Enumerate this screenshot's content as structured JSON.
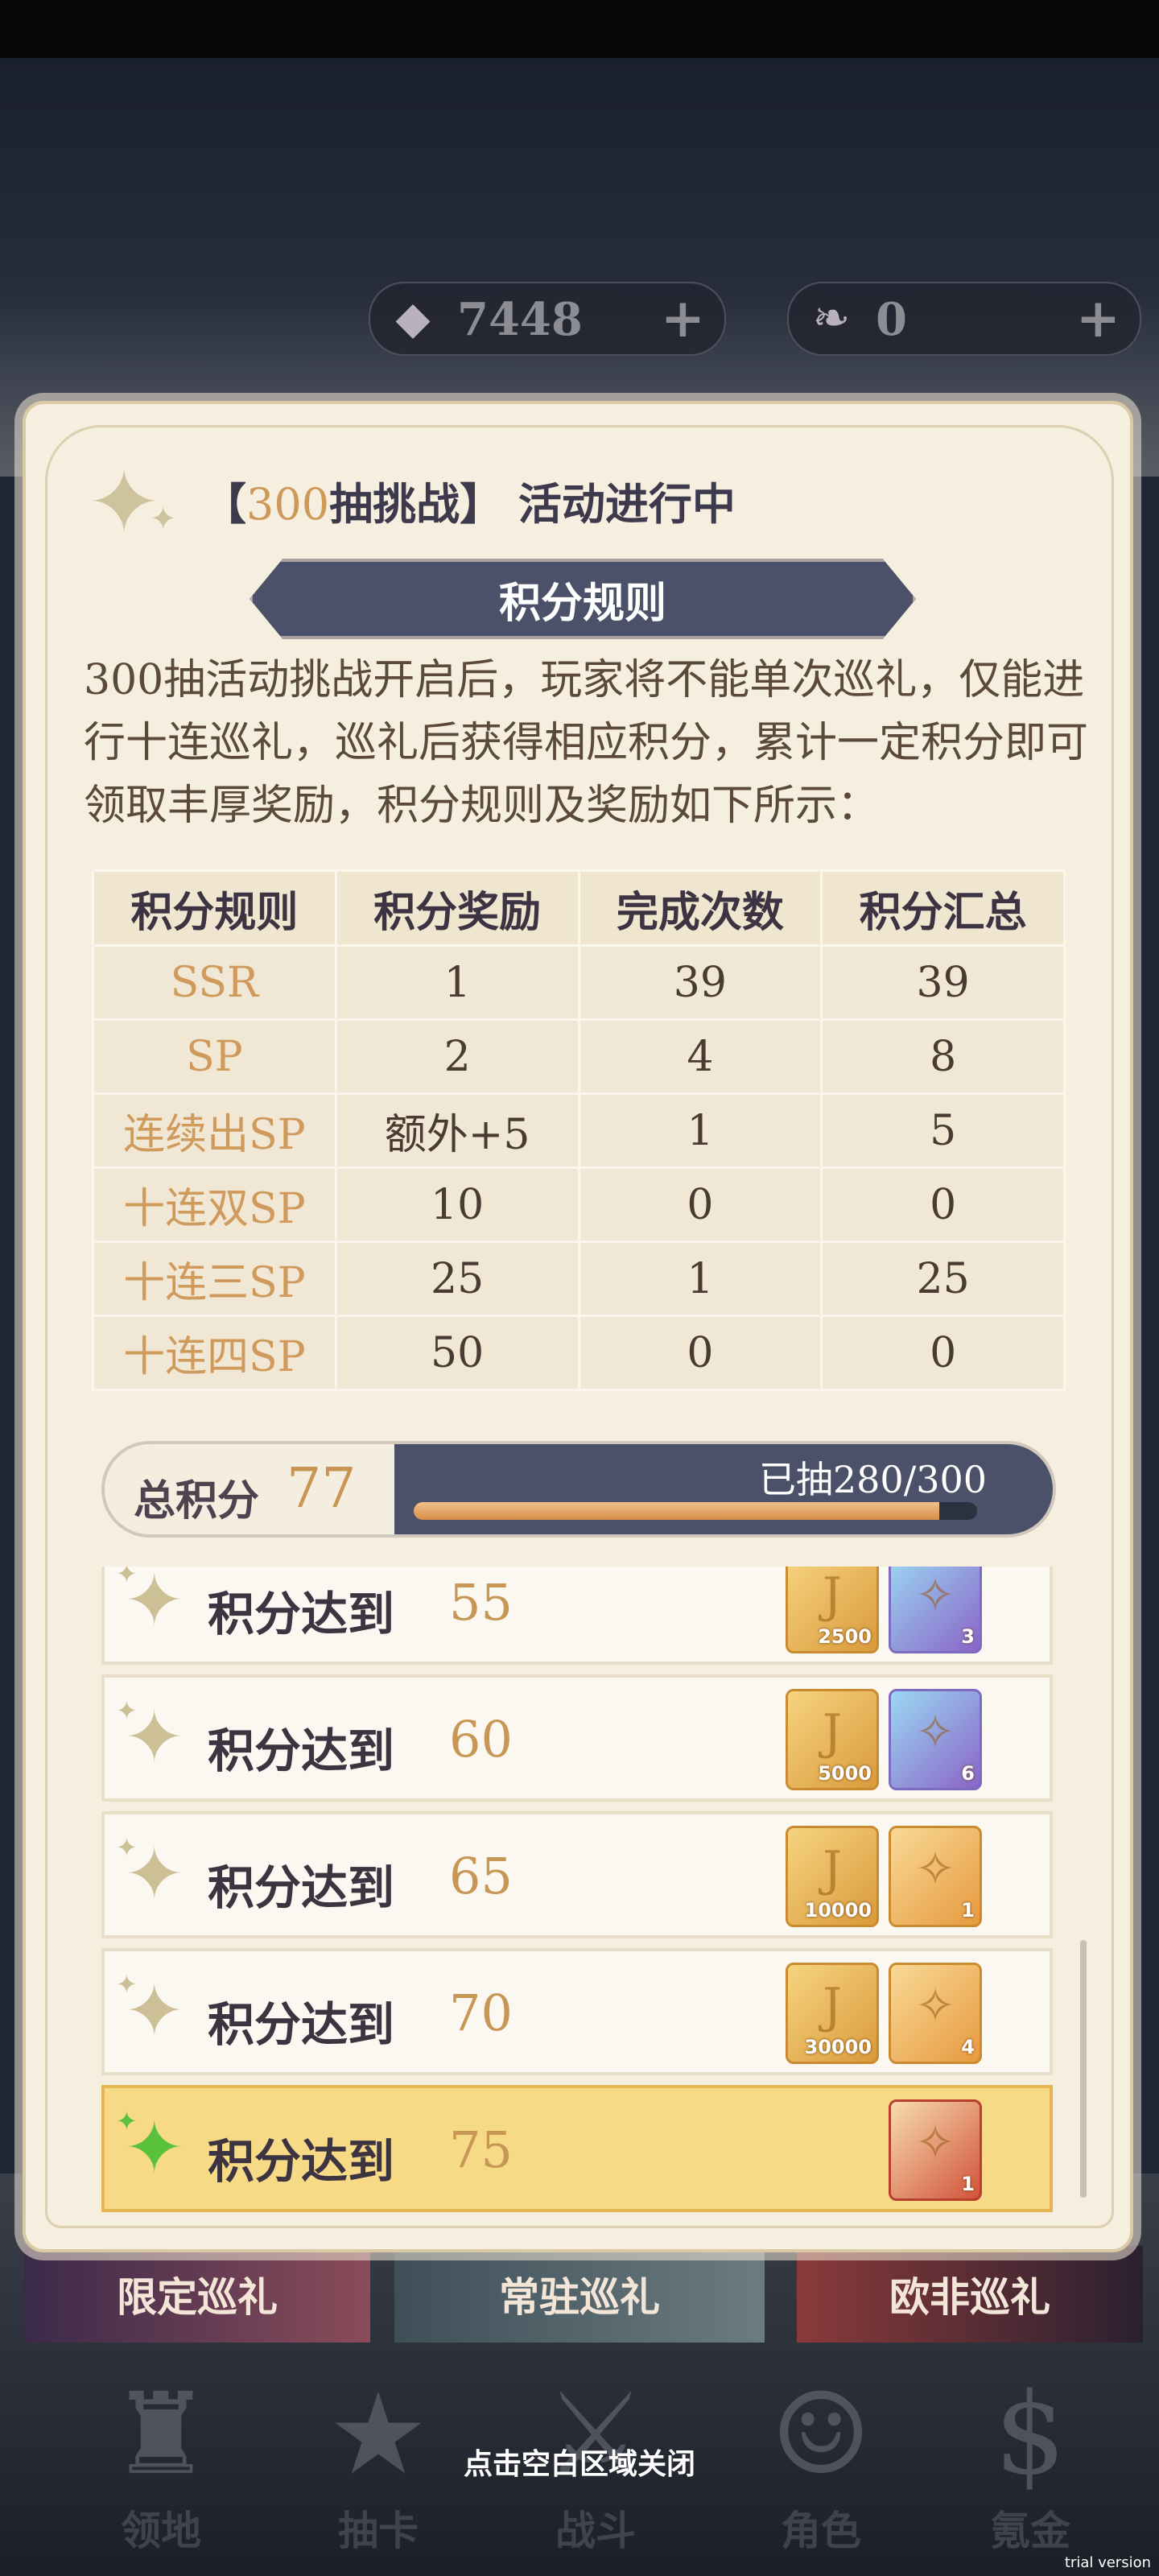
{
  "currencies": [
    {
      "icon": "crystal-icon",
      "amount": "7448",
      "plus": "+"
    },
    {
      "icon": "scroll-icon",
      "amount": "0",
      "plus": "+"
    }
  ],
  "panel": {
    "title_open": "【",
    "title_num": "300",
    "title_rest": "抽挑战】 活动进行中",
    "section_banner": "积分规则",
    "description": "300抽活动挑战开启后，玩家将不能单次巡礼，仅能进行十连巡礼，巡礼后获得相应积分，累计一定积分即可领取丰厚奖励，积分规则及奖励如下所示："
  },
  "rules_table": {
    "headers": [
      "积分规则",
      "积分奖励",
      "完成次数",
      "积分汇总"
    ],
    "rows": [
      [
        "SSR",
        "1",
        "39",
        "39"
      ],
      [
        "SP",
        "2",
        "4",
        "8"
      ],
      [
        "连续出SP",
        "额外+5",
        "1",
        "5"
      ],
      [
        "十连双SP",
        "10",
        "0",
        "0"
      ],
      [
        "十连三SP",
        "25",
        "1",
        "25"
      ],
      [
        "十连四SP",
        "50",
        "0",
        "0"
      ]
    ]
  },
  "total": {
    "label": "总积分",
    "value": "77",
    "progress_text": "已抽280/300",
    "progress_fraction": 0.9333
  },
  "rewards": [
    {
      "label": "积分达到",
      "score": "55",
      "items": [
        {
          "type": "gold-ticket",
          "count": "2500"
        },
        {
          "type": "purple-card",
          "count": "3"
        }
      ],
      "active": false
    },
    {
      "label": "积分达到",
      "score": "60",
      "items": [
        {
          "type": "gold-ticket",
          "count": "5000"
        },
        {
          "type": "purple-card",
          "count": "6"
        }
      ],
      "active": false
    },
    {
      "label": "积分达到",
      "score": "65",
      "items": [
        {
          "type": "gold-ticket",
          "count": "10000"
        },
        {
          "type": "orange-card",
          "count": "1"
        }
      ],
      "active": false
    },
    {
      "label": "积分达到",
      "score": "70",
      "items": [
        {
          "type": "gold-ticket",
          "count": "30000"
        },
        {
          "type": "orange-card",
          "count": "4"
        }
      ],
      "active": false
    },
    {
      "label": "积分达到",
      "score": "75",
      "items": [
        {
          "type": "red-card",
          "count": "1"
        }
      ],
      "active": true
    }
  ],
  "banner_tabs": [
    "限定巡礼",
    "常驻巡礼",
    "欧非巡礼"
  ],
  "nav": [
    "领地",
    "抽卡",
    "战斗",
    "角色",
    "氪金"
  ],
  "close_hint": "点击空白区域关闭",
  "watermark": "trial version",
  "colors": {
    "accent": "#cd9858",
    "banner": "#4a5168",
    "active_row": "#f7da86",
    "sparkle_active": "#59c13a"
  }
}
